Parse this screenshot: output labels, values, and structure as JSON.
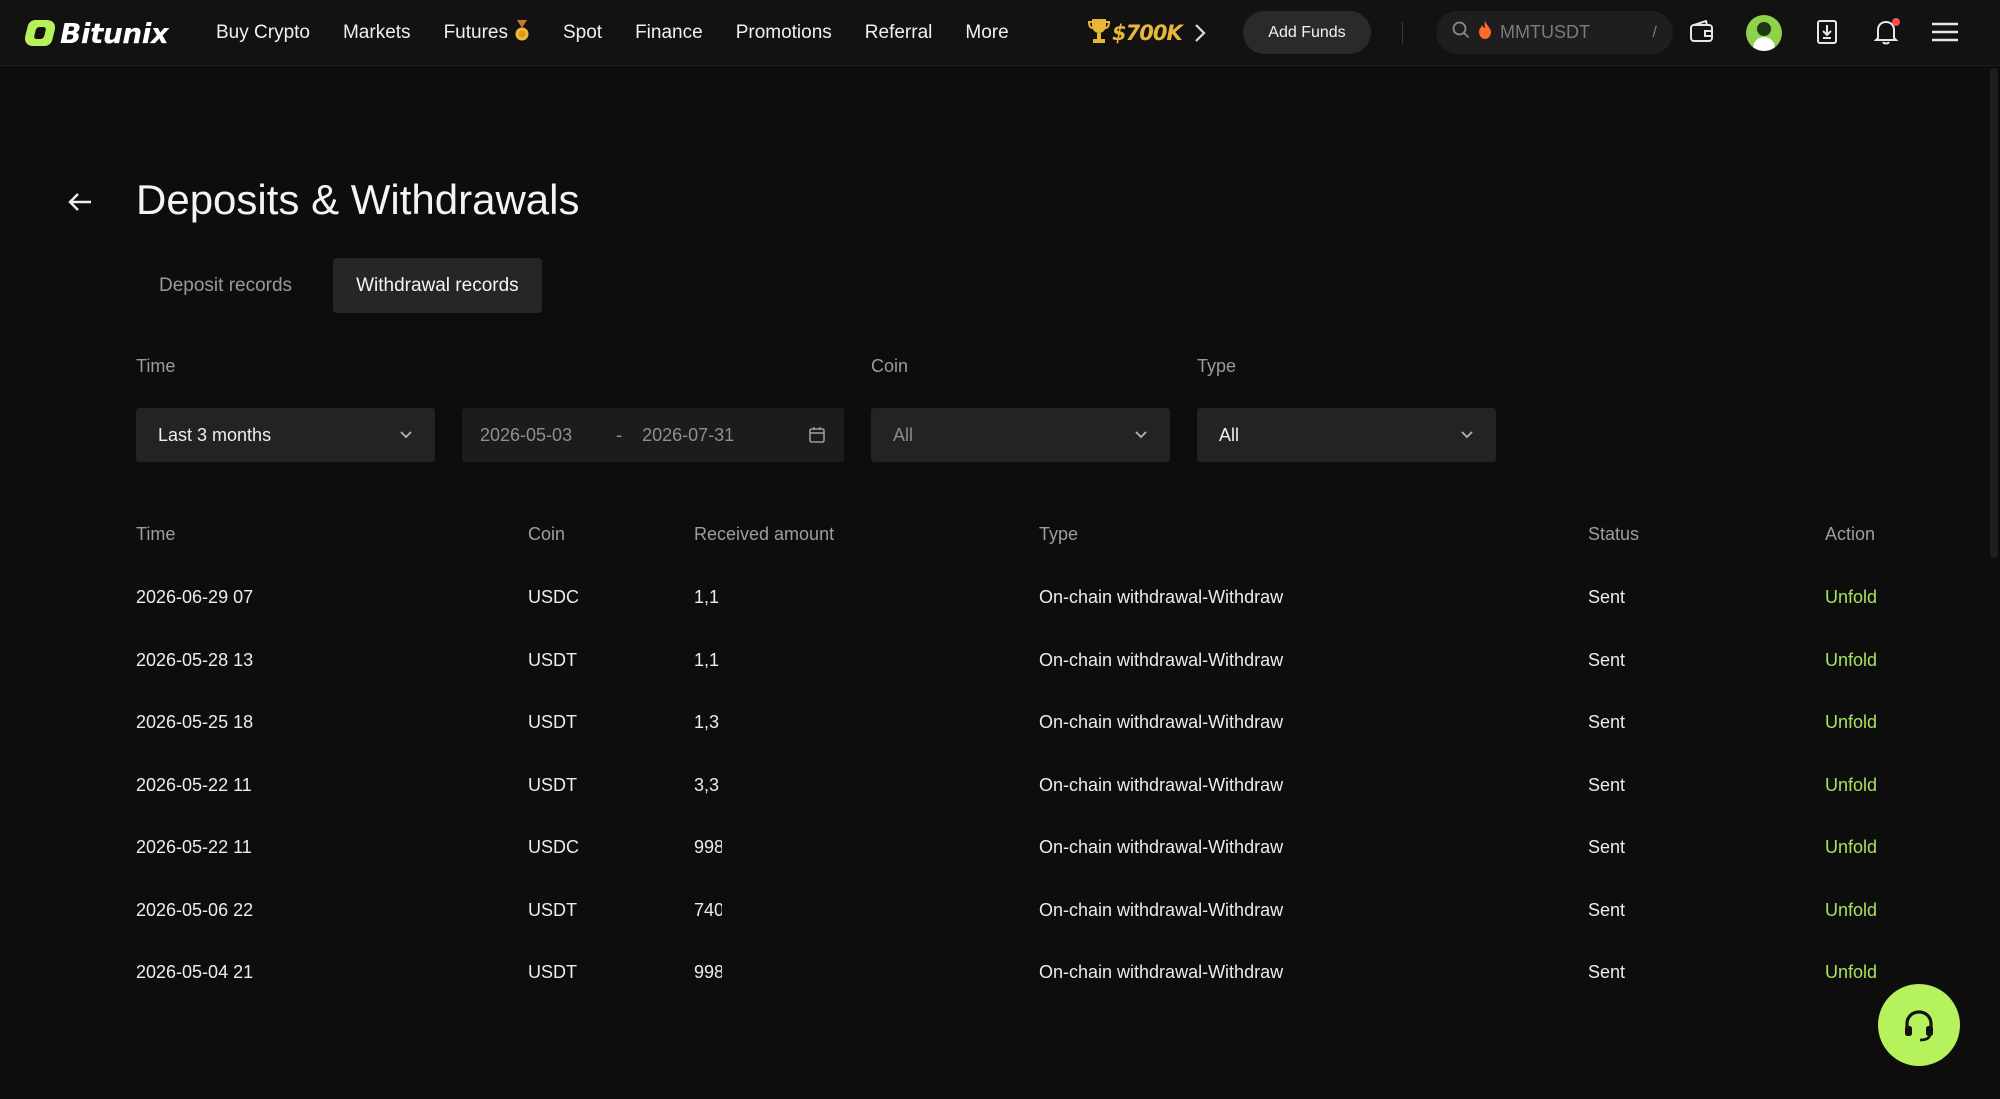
{
  "brand": {
    "name": "Bitunix",
    "accent": "#b6f05a"
  },
  "nav": {
    "items": [
      "Buy Crypto",
      "Markets",
      "Futures",
      "Spot",
      "Finance",
      "Promotions",
      "Referral",
      "More"
    ],
    "futures_badge": "medal-icon",
    "promo": "$700K",
    "add_funds": "Add Funds",
    "search_placeholder": "MMTUSDT",
    "search_shortcut": "/"
  },
  "page": {
    "title": "Deposits & Withdrawals"
  },
  "tabs": [
    {
      "label": "Deposit records",
      "active": false
    },
    {
      "label": "Withdrawal records",
      "active": true
    }
  ],
  "filters": {
    "time_label": "Time",
    "time_value": "Last 3 months",
    "date_start": "2026-05-03",
    "date_sep": "-",
    "date_end": "2026-07-31",
    "coin_label": "Coin",
    "coin_value": "All",
    "type_label": "Type",
    "type_value": "All"
  },
  "table": {
    "headers": [
      "Time",
      "Coin",
      "Received amount",
      "Type",
      "Status",
      "Action"
    ],
    "rows": [
      {
        "time": "2026-06-29 07",
        "coin": "USDC",
        "amount": "1,1",
        "type": "On-chain withdrawal-Withdraw",
        "status": "Sent",
        "action": "Unfold"
      },
      {
        "time": "2026-05-28 13",
        "coin": "USDT",
        "amount": "1,1",
        "type": "On-chain withdrawal-Withdraw",
        "status": "Sent",
        "action": "Unfold"
      },
      {
        "time": "2026-05-25 18",
        "coin": "USDT",
        "amount": "1,3",
        "type": "On-chain withdrawal-Withdraw",
        "status": "Sent",
        "action": "Unfold"
      },
      {
        "time": "2026-05-22 11",
        "coin": "USDT",
        "amount": "3,3",
        "type": "On-chain withdrawal-Withdraw",
        "status": "Sent",
        "action": "Unfold"
      },
      {
        "time": "2026-05-22 11",
        "coin": "USDC",
        "amount": "998",
        "type": "On-chain withdrawal-Withdraw",
        "status": "Sent",
        "action": "Unfold"
      },
      {
        "time": "2026-05-06 22",
        "coin": "USDT",
        "amount": "740",
        "type": "On-chain withdrawal-Withdraw",
        "status": "Sent",
        "action": "Unfold"
      },
      {
        "time": "2026-05-04 21",
        "coin": "USDT",
        "amount": "998",
        "type": "On-chain withdrawal-Withdraw",
        "status": "Sent",
        "action": "Unfold"
      }
    ]
  },
  "icons": {
    "back": "arrow-left-icon",
    "search": "search-icon",
    "wallet": "wallet-icon",
    "download": "download-icon",
    "bell": "bell-icon",
    "menu": "hamburger-menu-icon",
    "support": "headset-icon"
  },
  "colors": {
    "background": "#0d0d0d",
    "action": "#a6e35c",
    "promo": "#e8b739"
  }
}
